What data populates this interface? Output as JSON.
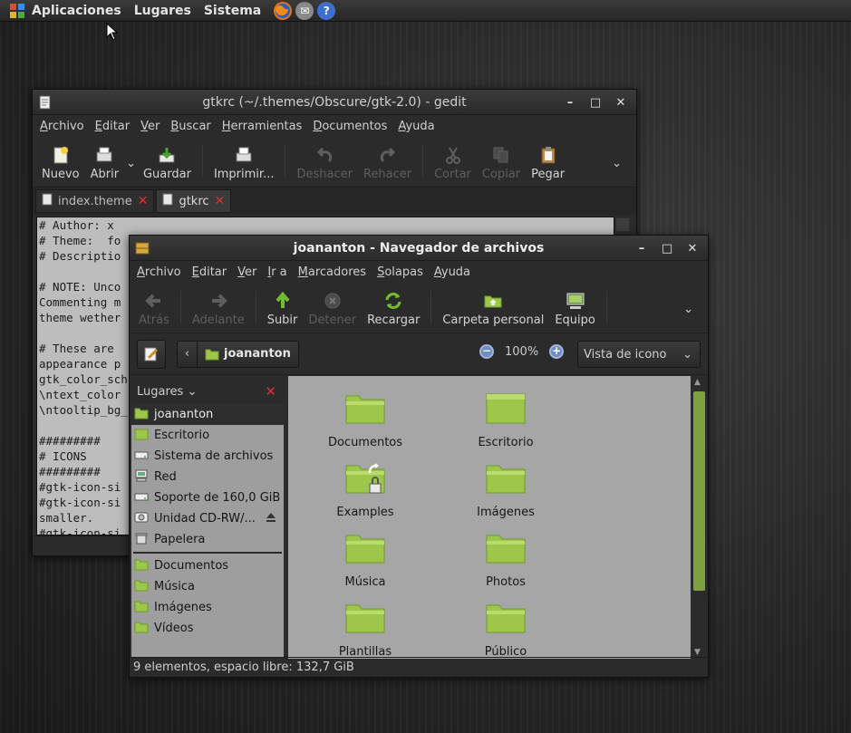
{
  "panel": {
    "menus": [
      "Aplicaciones",
      "Lugares",
      "Sistema"
    ],
    "launchers": [
      {
        "icon": "firefox-icon",
        "glyph": "",
        "color": "#e8731d"
      },
      {
        "icon": "mail-icon",
        "glyph": "✉",
        "color": "#8a8a8a"
      },
      {
        "icon": "help-icon",
        "glyph": "?",
        "color": "#3d6fcf"
      }
    ]
  },
  "gedit": {
    "title": "gtkrc (~/.themes/Obscure/gtk-2.0) - gedit",
    "menus": [
      "Archivo",
      "Editar",
      "Ver",
      "Buscar",
      "Herramientas",
      "Documentos",
      "Ayuda"
    ],
    "toolbar": {
      "new": "Nuevo",
      "open": "Abrir",
      "save": "Guardar",
      "print": "Imprimir...",
      "undo": "Deshacer",
      "redo": "Rehacer",
      "cut": "Cortar",
      "copy": "Copiar",
      "paste": "Pegar"
    },
    "tabs": [
      {
        "label": "index.theme",
        "active": false
      },
      {
        "label": "gtkrc",
        "active": true
      }
    ],
    "lines": [
      "# Author: x",
      "# Theme:  fo",
      "# Descriptio",
      "",
      "# NOTE: Unco",
      "Commenting m",
      "theme wether",
      "",
      "# These are ",
      "appearance p",
      "gtk_color_sch",
      "\\ntext_color",
      "\\ntooltip_bg_",
      "",
      "#########",
      "# ICONS",
      "#########",
      "#gtk-icon-si",
      "#gtk-icon-si",
      "smaller.",
      "#gtk-icon-si"
    ]
  },
  "nautilus": {
    "title": "joananton - Navegador de archivos",
    "menus": [
      "Archivo",
      "Editar",
      "Ver",
      "Ir a",
      "Marcadores",
      "Solapas",
      "Ayuda"
    ],
    "toolbar": {
      "back": "Atrás",
      "forward": "Adelante",
      "up": "Subir",
      "stop": "Detener",
      "reload": "Recargar",
      "home": "Carpeta personal",
      "computer": "Equipo"
    },
    "location": "joananton",
    "zoom": "100%",
    "view": "Vista de icono",
    "sidebar": {
      "header": "Lugares",
      "places": [
        {
          "label": "joananton",
          "icon": "home-folder-icon",
          "selected": true
        },
        {
          "label": "Escritorio",
          "icon": "desktop-folder-icon",
          "selected": false
        },
        {
          "label": "Sistema de archivos",
          "icon": "drive-icon",
          "selected": false
        },
        {
          "label": "Red",
          "icon": "network-icon",
          "selected": false
        },
        {
          "label": "Soporte de 160,0 GiB",
          "icon": "drive-icon",
          "selected": false
        },
        {
          "label": "Unidad CD-RW/...",
          "icon": "cdrom-icon",
          "selected": false,
          "eject": true
        },
        {
          "label": "Papelera",
          "icon": "trash-icon",
          "selected": false
        }
      ],
      "bookmarks": [
        {
          "label": "Documentos",
          "icon": "folder-icon"
        },
        {
          "label": "Música",
          "icon": "folder-icon"
        },
        {
          "label": "Imágenes",
          "icon": "folder-icon"
        },
        {
          "label": "Vídeos",
          "icon": "folder-icon"
        }
      ]
    },
    "files": [
      {
        "label": "Documentos",
        "type": "folder"
      },
      {
        "label": "Escritorio",
        "type": "desktop"
      },
      {
        "label": "Examples",
        "type": "link-locked"
      },
      {
        "label": "Imágenes",
        "type": "folder"
      },
      {
        "label": "Música",
        "type": "folder"
      },
      {
        "label": "Photos",
        "type": "folder"
      },
      {
        "label": "Plantillas",
        "type": "folder"
      },
      {
        "label": "Público",
        "type": "folder"
      }
    ],
    "status": "9 elementos, espacio libre: 132,7 GiB"
  },
  "colors": {
    "folder": "#9dc74a",
    "folder_dark": "#6f9a2a",
    "close_red": "#e23030",
    "accent": "#7fa03f"
  }
}
